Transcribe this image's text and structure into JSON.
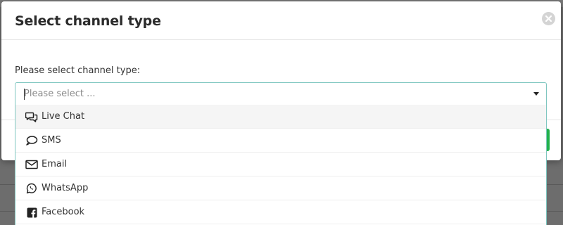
{
  "modal": {
    "title": "Select channel type",
    "field_label": "Please select channel type:"
  },
  "select": {
    "placeholder": "Please select ...",
    "options": [
      {
        "label": "Live Chat",
        "icon": "live-chat-icon"
      },
      {
        "label": "SMS",
        "icon": "sms-bubble-icon"
      },
      {
        "label": "Email",
        "icon": "email-envelope-icon"
      },
      {
        "label": "WhatsApp",
        "icon": "whatsapp-icon"
      },
      {
        "label": "Facebook",
        "icon": "facebook-icon"
      }
    ]
  },
  "colors": {
    "accent_border": "#7fc6c0",
    "confirm_green": "#22b14c",
    "backdrop": "#6d6d6d"
  }
}
